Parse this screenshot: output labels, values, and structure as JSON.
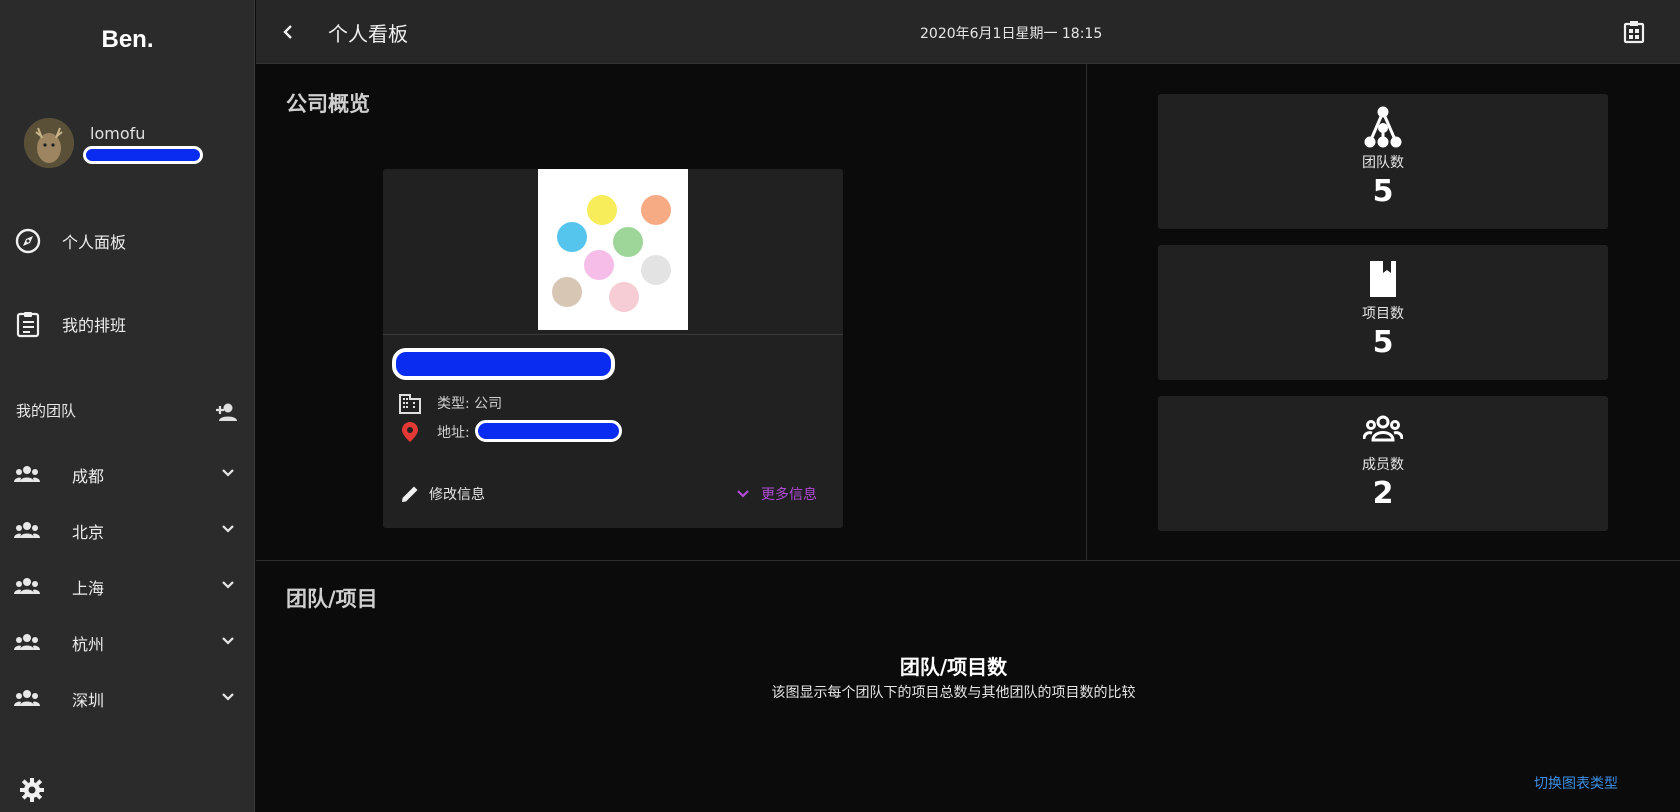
{
  "app": {
    "logo": "Ben."
  },
  "user": {
    "name": "lomofu"
  },
  "nav": [
    {
      "label": "个人面板",
      "icon": "compass-icon"
    },
    {
      "label": "我的排班",
      "icon": "clipboard-list-icon"
    }
  ],
  "teams": {
    "header": "我的团队",
    "items": [
      {
        "label": "成都"
      },
      {
        "label": "北京"
      },
      {
        "label": "上海"
      },
      {
        "label": "杭州"
      },
      {
        "label": "深圳"
      }
    ]
  },
  "header": {
    "title": "个人看板",
    "datetime": "2020年6月1日星期一 18:15"
  },
  "overview": {
    "title": "公司概览",
    "company": {
      "type_label": "类型: 公司",
      "address_label": "地址: ",
      "edit_label": "修改信息",
      "more_label": "更多信息"
    }
  },
  "stats": [
    {
      "label": "团队数",
      "value": "5",
      "icon": "hierarchy-icon"
    },
    {
      "label": "项目数",
      "value": "5",
      "icon": "book-icon"
    },
    {
      "label": "成员数",
      "value": "2",
      "icon": "group-icon"
    }
  ],
  "projects": {
    "title": "团队/项目",
    "chart_title": "团队/项目数",
    "chart_desc": "该图显示每个团队下的项目总数与其他团队的项目数的比较",
    "switch_label": "切换图表类型"
  },
  "colors": {
    "accent_purple": "#b14ad6",
    "link_blue": "#3b8ee0",
    "redaction_blue": "#0a2cf0",
    "location_red": "#e53935"
  }
}
